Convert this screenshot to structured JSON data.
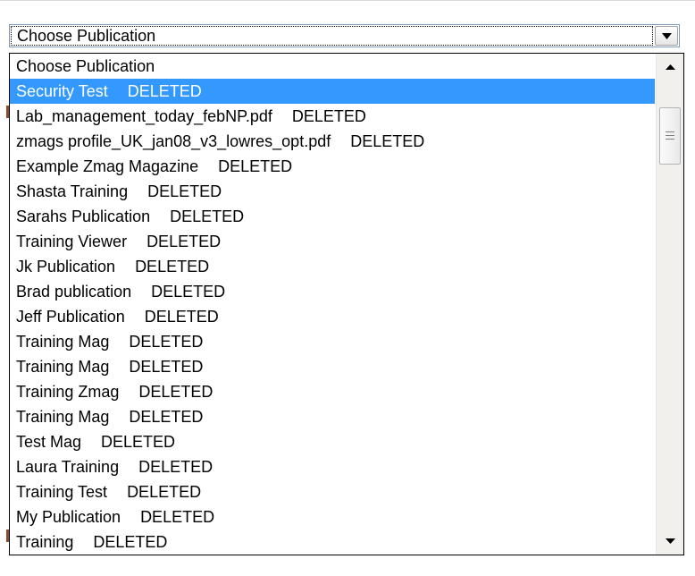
{
  "select": {
    "value": "Choose Publication"
  },
  "options": [
    {
      "name": "Choose Publication",
      "status": "",
      "selected": false
    },
    {
      "name": "Security Test",
      "status": "DELETED",
      "selected": true
    },
    {
      "name": "Lab_management_today_febNP.pdf",
      "status": "DELETED",
      "selected": false
    },
    {
      "name": "zmags profile_UK_jan08_v3_lowres_opt.pdf",
      "status": "DELETED",
      "selected": false
    },
    {
      "name": "Example Zmag Magazine",
      "status": "DELETED",
      "selected": false
    },
    {
      "name": "Shasta Training",
      "status": "DELETED",
      "selected": false
    },
    {
      "name": "Sarahs Publication",
      "status": "DELETED",
      "selected": false
    },
    {
      "name": "Training Viewer",
      "status": "DELETED",
      "selected": false
    },
    {
      "name": "Jk Publication",
      "status": "DELETED",
      "selected": false
    },
    {
      "name": "Brad publication",
      "status": "DELETED",
      "selected": false
    },
    {
      "name": "Jeff Publication",
      "status": "DELETED",
      "selected": false
    },
    {
      "name": "Training Mag",
      "status": "DELETED",
      "selected": false
    },
    {
      "name": "Training Mag",
      "status": "DELETED",
      "selected": false
    },
    {
      "name": "Training Zmag",
      "status": "DELETED",
      "selected": false
    },
    {
      "name": "Training Mag",
      "status": "DELETED",
      "selected": false
    },
    {
      "name": "Test Mag",
      "status": "DELETED",
      "selected": false
    },
    {
      "name": "Laura Training",
      "status": "DELETED",
      "selected": false
    },
    {
      "name": "Training Test",
      "status": "DELETED",
      "selected": false
    },
    {
      "name": "My Publication",
      "status": "DELETED",
      "selected": false
    },
    {
      "name": "Training",
      "status": "DELETED",
      "selected": false
    }
  ],
  "scrollbar": {
    "position_fraction": 0.05
  },
  "colors": {
    "selection": "#3399ff",
    "border": "#7f9db9"
  },
  "icons": {
    "select_arrow": "chevron-down-icon",
    "scroll_up": "scroll-up-arrow-icon",
    "scroll_down": "scroll-down-arrow-icon",
    "thumb_grip": "grip-icon"
  }
}
